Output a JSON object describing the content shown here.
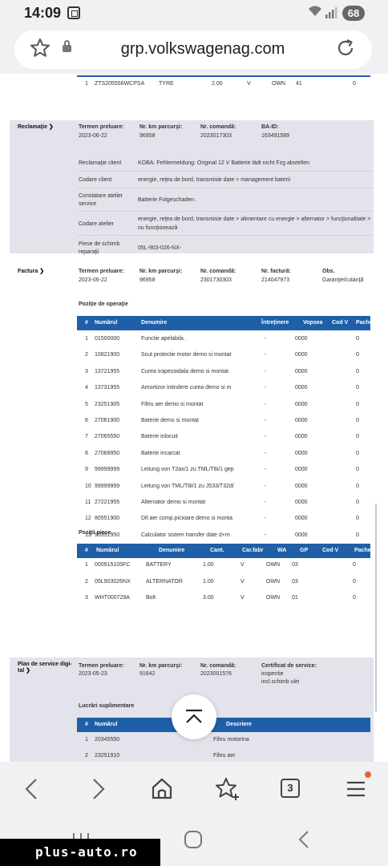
{
  "status_bar": {
    "time": "14:09",
    "battery": "68"
  },
  "browser": {
    "url": "grp.volkswagenag.com"
  },
  "top_row": {
    "num": "1",
    "part": "ZTS205556WCPSA",
    "desc": "TYRE",
    "qty": "2.00",
    "v": "V",
    "wa": "OWN",
    "gp": "41",
    "pachet": "0"
  },
  "reclamatie": {
    "name": "Reclamaţie",
    "labels": {
      "date": "Termen preluare:",
      "km": "Nr. km parcurşi:",
      "order": "Nr. comandă:",
      "ba": "BA-ID:"
    },
    "values": {
      "date": "2023-06-22",
      "km": "96958",
      "order": "2023017303",
      "ba": "163491589"
    },
    "details": [
      {
        "label": "Reclamaţie client",
        "value": "KOBA: Fehlermeldung: Original 12 V Batterie lädt nicht Fzg abstellen"
      },
      {
        "label": "Codare client",
        "value": "energie, reţea de bord, transmisie date > management baterii"
      },
      {
        "label": "Constatare atelier",
        "label2": "service",
        "value": "Batterie Folgeschaden ."
      },
      {
        "label": "Codare atelier",
        "value": "energie, reţea de bord, transmisie date > alimentare cu energie > alternator > funcţionalitate >",
        "value2": "nu funcţionează"
      },
      {
        "label": "Piese de schimb",
        "label2": "reparaţii",
        "value": "05L-903-026-NX-"
      }
    ]
  },
  "factura": {
    "name": "Factura",
    "labels": {
      "date": "Termen preluare:",
      "km": "Nr. km parcurşi:",
      "order": "Nr. comandă:",
      "invoice": "Nr. factură:",
      "obs": "Obs."
    },
    "values": {
      "date": "2023-06-22",
      "km": "96958",
      "order": "2301730303",
      "invoice": "214047973",
      "obs": "Garanţie/culanţă"
    },
    "ops": {
      "title": "Poziţie de operaţie",
      "headers": [
        "#",
        "Numărul",
        "Denumire",
        "Întreţinere",
        "Vopsea",
        "Cod V",
        "Pachet"
      ],
      "rows": [
        [
          "1",
          "01500000",
          "Functie apelabila .",
          "-",
          "0000",
          "",
          "0"
        ],
        [
          "2",
          "10821900",
          "Scut protectie motor demo si montat",
          "-",
          "0000",
          "",
          "0"
        ],
        [
          "3",
          "13721955",
          "Curea trapezoidala demo si montat",
          "-",
          "0000",
          "",
          "0"
        ],
        [
          "4",
          "13731955",
          "Amortizor intindere curea demo si m",
          "-",
          "0000",
          "",
          "0"
        ],
        [
          "5",
          "23251905",
          "Filtru aer demo si montat",
          "-",
          "0000",
          "",
          "0"
        ],
        [
          "6",
          "27061900",
          "Baterie demo si montat",
          "-",
          "0000",
          "",
          "0"
        ],
        [
          "7",
          "27065550",
          "Baterie inlocuit",
          "-",
          "0000",
          "",
          "0"
        ],
        [
          "8",
          "27068950",
          "Baterie incarcat",
          "-",
          "0000",
          "",
          "0"
        ],
        [
          "9",
          "99999999",
          "Leitung von T2ax/1 zu TML/T8i/1 gep",
          "-",
          "0000",
          "",
          "0"
        ],
        [
          "10",
          "99999999",
          "Leitung von TML/T8i/1 zu J533/T32d/",
          "-",
          "0000",
          "",
          "0"
        ],
        [
          "11",
          "27221955",
          "Alternator demo si montat",
          "-",
          "0000",
          "",
          "0"
        ],
        [
          "12",
          "80551900",
          "Dif.aer comp.picioare demo si monta",
          "-",
          "0000",
          "",
          "0"
        ],
        [
          "13",
          "90351950",
          "Calculator sistem transfer date d+m",
          "-",
          "0000",
          "",
          "0"
        ]
      ]
    },
    "parts": {
      "title": "Poziţii piese",
      "headers": [
        "#",
        "Numărul",
        "Denumire",
        "Cant.",
        "Car.fabr",
        "WA",
        "GP",
        "Cod V",
        "Pachet"
      ],
      "rows": [
        [
          "1",
          "000915105FC",
          "BATTERY",
          "1.00",
          "V",
          "OWN",
          "03",
          "",
          "0"
        ],
        [
          "2",
          "05L903026NX",
          "ALTERNATOR",
          "1.00",
          "V",
          "OWN",
          "03",
          "",
          "0"
        ],
        [
          "3",
          "WHT000729A",
          "Bolt",
          "3.00",
          "V",
          "OWN",
          "01",
          "",
          "0"
        ]
      ]
    }
  },
  "service_plan": {
    "name": "Plan de service digi-",
    "name2": "tal",
    "labels": {
      "date": "Termen preluare:",
      "km": "Nr. km parcurşi:",
      "order": "Nr. comandă:",
      "cert": "Certificat de service:"
    },
    "values": {
      "date": "2023-05-23",
      "km": "91642",
      "order": "2023001576",
      "cert": "inspectie",
      "cert2": "incl.schimb ulei"
    },
    "extra": {
      "title": "Lucrări suplimentare",
      "headers": [
        "#",
        "Numărul",
        "Descriere"
      ],
      "rows": [
        [
          "1",
          "20345550",
          "Filtru motorina"
        ],
        [
          "2",
          "23251910",
          "Filtru aer"
        ]
      ]
    }
  },
  "watermark": "plus-auto.ro"
}
